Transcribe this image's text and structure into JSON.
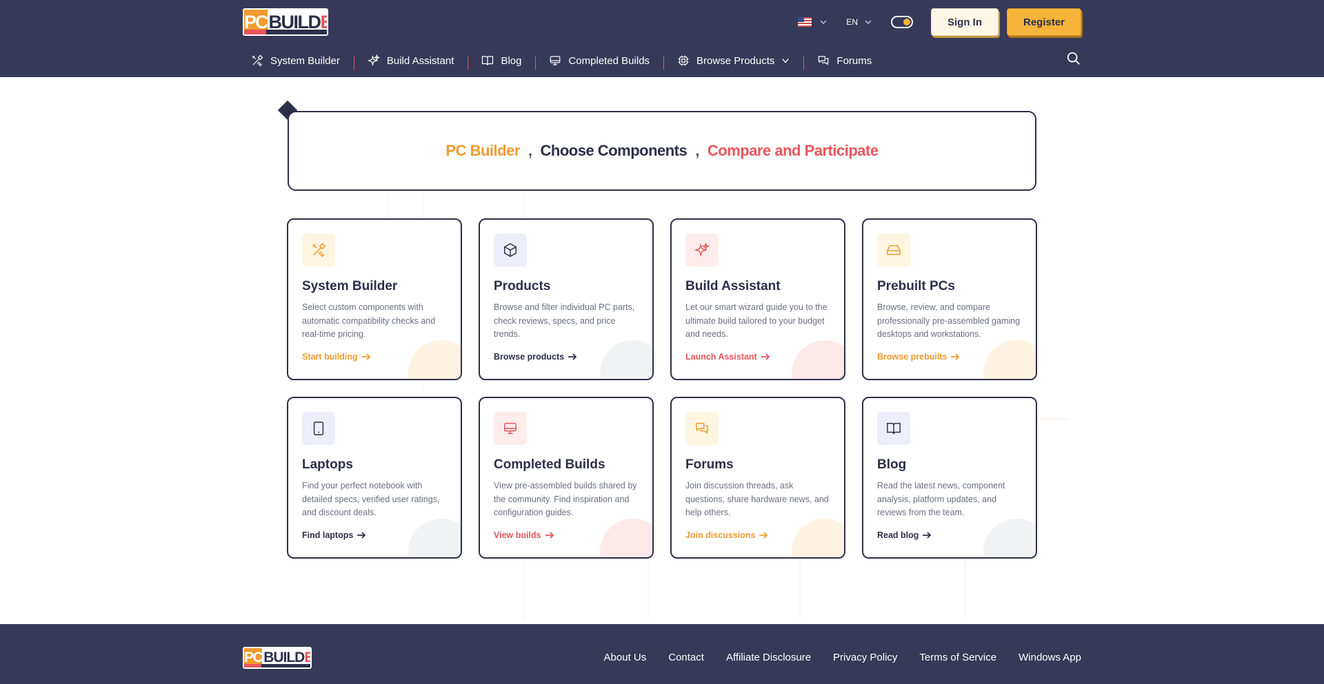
{
  "header": {
    "logo_pc": "PC",
    "logo_build": "BUILD",
    "logo_er": "ER",
    "language": "EN",
    "sign_in": "Sign In",
    "register": "Register"
  },
  "nav": {
    "items": [
      {
        "label": "System Builder",
        "icon": "tools-icon"
      },
      {
        "label": "Build Assistant",
        "icon": "sparkles-icon"
      },
      {
        "label": "Blog",
        "icon": "book-icon"
      },
      {
        "label": "Completed Builds",
        "icon": "monitor-icon"
      },
      {
        "label": "Browse Products",
        "icon": "cpu-icon"
      },
      {
        "label": "Forums",
        "icon": "chat-icon"
      }
    ]
  },
  "hero": {
    "part1": "PC Builder",
    "sep": ",",
    "part2": "Choose Components",
    "part3": "Compare and Participate"
  },
  "cards": [
    {
      "title": "System Builder",
      "desc": "Select custom components with automatic compatibility checks and real-time pricing.",
      "link": "Start building",
      "icon": "tools-icon",
      "accent": "#f29a2e"
    },
    {
      "title": "Products",
      "desc": "Browse and filter individual PC parts, check reviews, specs, and price trends.",
      "link": "Browse products",
      "icon": "box-icon",
      "accent": "#2c2f4a"
    },
    {
      "title": "Build Assistant",
      "desc": "Let our smart wizard guide you to the ultimate build tailored to your budget and needs.",
      "link": "Launch Assistant",
      "icon": "sparkles-icon",
      "accent": "#e8555b"
    },
    {
      "title": "Prebuilt PCs",
      "desc": "Browse, review, and compare professionally pre-assembled gaming desktops and workstations.",
      "link": "Browse prebuilts",
      "icon": "hard-drive-icon",
      "accent": "#f29a2e"
    },
    {
      "title": "Laptops",
      "desc": "Find your perfect notebook with detailed specs, verified user ratings, and discount deals.",
      "link": "Find laptops",
      "icon": "tablet-icon",
      "accent": "#2c2f4a"
    },
    {
      "title": "Completed Builds",
      "desc": "View pre-assembled builds shared by the community. Find inspiration and configuration guides.",
      "link": "View builds",
      "icon": "monitor-icon",
      "accent": "#e8555b"
    },
    {
      "title": "Forums",
      "desc": "Join discussion threads, ask questions, share hardware news, and help others.",
      "link": "Join discussions",
      "icon": "chat-icon",
      "accent": "#f29a2e"
    },
    {
      "title": "Blog",
      "desc": "Read the latest news, component analysis, platform updates, and reviews from the team.",
      "link": "Read blog",
      "icon": "book-icon",
      "accent": "#2c2f4a"
    }
  ],
  "footer": {
    "links": [
      "About Us",
      "Contact",
      "Affiliate Disclosure",
      "Privacy Policy",
      "Terms of Service",
      "Windows App"
    ]
  }
}
